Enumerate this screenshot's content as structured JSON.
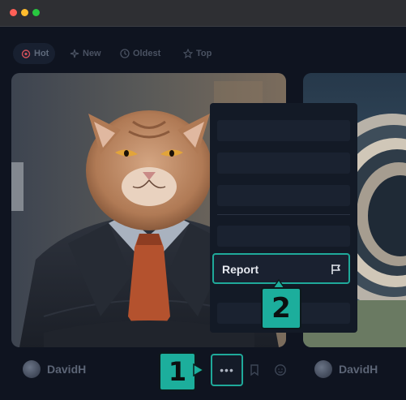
{
  "window": {
    "controls": [
      "close",
      "minimize",
      "maximize"
    ]
  },
  "filters": [
    {
      "label": "Hot",
      "icon": "flame-icon",
      "active": true
    },
    {
      "label": "New",
      "icon": "sparkle-icon",
      "active": false
    },
    {
      "label": "Oldest",
      "icon": "clock-icon",
      "active": false
    },
    {
      "label": "Top",
      "icon": "star-icon",
      "active": false
    }
  ],
  "cards": [
    {
      "author": "DavidH",
      "image": "cat in business suit"
    },
    {
      "author": "DavidH",
      "image": "circular architecture"
    }
  ],
  "context_menu": {
    "report_label": "Report",
    "report_icon": "flag-icon"
  },
  "annotations": {
    "step1": "1",
    "step2": "2"
  },
  "colors": {
    "accent": "#1fa99a",
    "background": "#0f1420"
  }
}
